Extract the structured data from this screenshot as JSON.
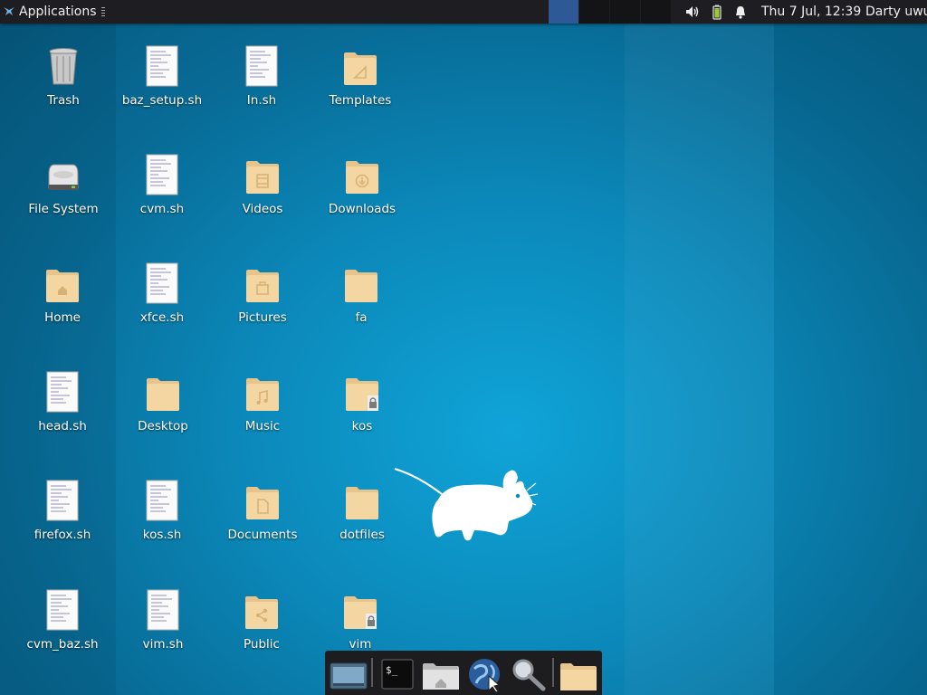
{
  "panel": {
    "applications_label": "Applications",
    "clock": "Thu  7 Jul, 12:39",
    "user": "Darty uwu",
    "workspaces": 4,
    "active_workspace": 1,
    "tray_icons": [
      "volume-icon",
      "battery-icon",
      "notification-bell-icon"
    ]
  },
  "desktop": {
    "icons": [
      {
        "label": "Trash",
        "icon": "trash-icon"
      },
      {
        "label": "baz_setup.sh",
        "icon": "script-file-icon"
      },
      {
        "label": "In.sh",
        "icon": "script-file-icon"
      },
      {
        "label": "Templates",
        "icon": "folder-icon"
      },
      {
        "label": "File System",
        "icon": "hard-drive-icon"
      },
      {
        "label": "cvm.sh",
        "icon": "script-file-icon"
      },
      {
        "label": "Videos",
        "icon": "folder-icon"
      },
      {
        "label": "Downloads",
        "icon": "folder-icon"
      },
      {
        "label": "Home",
        "icon": "folder-icon"
      },
      {
        "label": "xfce.sh",
        "icon": "script-file-icon"
      },
      {
        "label": "Pictures",
        "icon": "folder-icon"
      },
      {
        "label": "fa",
        "icon": "folder-icon"
      },
      {
        "label": "head.sh",
        "icon": "script-file-icon"
      },
      {
        "label": "Desktop",
        "icon": "folder-icon"
      },
      {
        "label": "Music",
        "icon": "folder-icon"
      },
      {
        "label": "kos",
        "icon": "folder-icon"
      },
      {
        "label": "firefox.sh",
        "icon": "script-file-icon"
      },
      {
        "label": "kos.sh",
        "icon": "script-file-icon"
      },
      {
        "label": "Documents",
        "icon": "folder-icon"
      },
      {
        "label": "dotfiles",
        "icon": "folder-icon"
      },
      {
        "label": "cvm_baz.sh",
        "icon": "script-file-icon"
      },
      {
        "label": "vim.sh",
        "icon": "script-file-icon"
      },
      {
        "label": "Public",
        "icon": "folder-icon"
      },
      {
        "label": "vim",
        "icon": "folder-icon"
      }
    ]
  },
  "dock": {
    "launchers": [
      "show-desktop-icon",
      "terminal-icon",
      "home-folder-icon",
      "web-browser-icon",
      "search-icon",
      "folder-icon"
    ]
  },
  "colors": {
    "desktop_base": "#0b88b9",
    "panel_bg": "#1e1e22",
    "active_workspace": "#2d5a96",
    "folder": "#f3d6a2",
    "battery": "#9acd32"
  }
}
